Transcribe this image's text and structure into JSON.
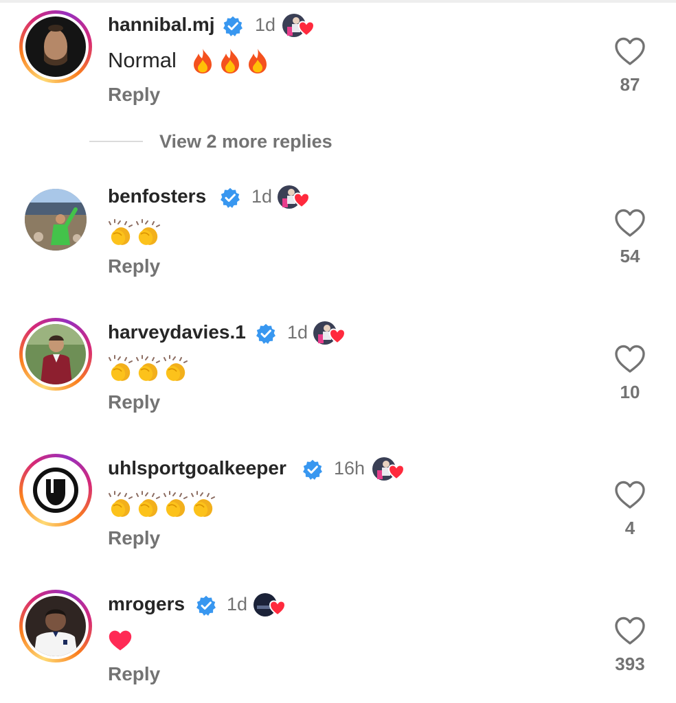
{
  "comments": [
    {
      "username": "hannibal.mj",
      "time": "1d",
      "text": "Normal",
      "emoji": "fire",
      "emoji_count": 3,
      "reply_label": "Reply",
      "likes": "87"
    },
    {
      "username": "benfosters",
      "time": "1d",
      "text": "",
      "emoji": "clap",
      "emoji_count": 2,
      "reply_label": "Reply",
      "likes": "54"
    },
    {
      "username": "harveydavies.1",
      "time": "1d",
      "text": "",
      "emoji": "clap",
      "emoji_count": 3,
      "reply_label": "Reply",
      "likes": "10"
    },
    {
      "username": "uhlsportgoalkeeper",
      "time": "16h",
      "text": "",
      "emoji": "clap",
      "emoji_count": 4,
      "reply_label": "Reply",
      "likes": "4"
    },
    {
      "username": "mrogers",
      "time": "1d",
      "text": "",
      "emoji": "heart",
      "emoji_count": 1,
      "reply_label": "Reply",
      "likes": "393"
    }
  ],
  "view_more_replies": "View 2 more replies",
  "icons": {
    "verified": "verified-badge-icon",
    "like": "heart-outline-icon",
    "liked_by_author": "liked-by-author-badge"
  },
  "colors": {
    "verified": "#3897f0",
    "secondary_text": "#737373",
    "primary_text": "#262626",
    "heart": "#ff2a55"
  }
}
